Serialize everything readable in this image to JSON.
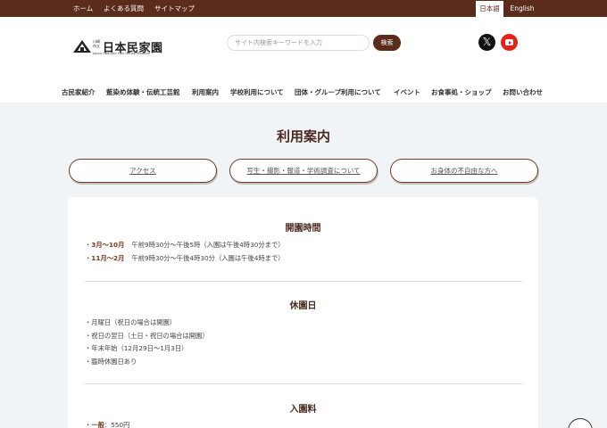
{
  "topbar": {
    "links": [
      "ホーム",
      "よくある質問",
      "サイトマップ"
    ],
    "lang_active": "日本語",
    "lang_other": "English"
  },
  "logo": {
    "small": "川崎市立",
    "kanji": "日本民家園",
    "en": "Japan Open-Air Folk House Museum"
  },
  "search": {
    "placeholder": "サイト内検索キーワードを入力",
    "button": "検索"
  },
  "sns": {
    "x_glyph": "𝕏"
  },
  "nav": [
    "古民家紹介",
    "藍染め体験・伝統工芸館",
    "利用案内",
    "学校利用について",
    "団体・グループ利用について",
    "イベント",
    "お食事処・ショップ",
    "お問い合わせ"
  ],
  "page_title": "利用案内",
  "tabs": [
    "アクセス",
    "写生・撮影・報道・学術調査について",
    "お身体の不自由な方へ"
  ],
  "sections": {
    "hours": {
      "title": "開園時間",
      "rows": [
        {
          "label": "3月〜10月",
          "text": "午前9時30分〜午後5時（入園は午後4時30分まで）"
        },
        {
          "label": "11月〜2月",
          "text": "午前9時30分〜午後4時30分（入園は午後4時まで）"
        }
      ]
    },
    "closed": {
      "title": "休園日",
      "items": [
        "月曜日（祝日の場合は開園）",
        "祝日の翌日（土日・祝日の場合は開園）",
        "年末年始（12月29日〜1月3日）",
        "臨時休園日あり"
      ]
    },
    "fee": {
      "title": "入園料",
      "rows": [
        {
          "label": "一般",
          "text": "550円"
        }
      ]
    }
  },
  "colors": {
    "brand": "#5b2b1c",
    "background": "#f1f4f6",
    "youtube": "#e62117"
  }
}
